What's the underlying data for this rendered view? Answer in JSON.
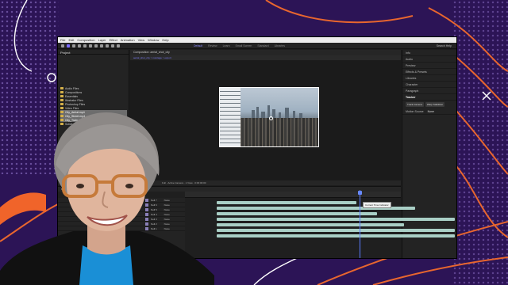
{
  "colors": {
    "background": "#2c1456",
    "accent_orange": "#f0642a",
    "app_bg": "#1d1d1d",
    "track_bar": "#a9cfc6",
    "playhead": "#5a7cff",
    "folder": "#d4b04a"
  },
  "menu": [
    "File",
    "Edit",
    "Composition",
    "Layer",
    "Effect",
    "Animation",
    "View",
    "Window",
    "Help"
  ],
  "toolbar": {
    "workspaces": [
      "Default",
      "Review",
      "Learn",
      "Small Screen",
      "Standard",
      "Libraries"
    ],
    "search_label": "Search Help"
  },
  "project_panel": {
    "title": "Project",
    "items": [
      "Audio Files",
      "Compositions",
      "Essentials",
      "Illustrator Files",
      "Photoshop Files",
      "Video Files",
      "City_Aerial.mp4",
      "City_Street.mp4",
      "City_Train.mp4",
      "Solids"
    ]
  },
  "composition": {
    "tab": "Composition: aerial_shot_city",
    "path": "aerial_shot_city  >  montage  >  export",
    "footer": "Full  ·  Active Camera  ·  1 View  ·  0:00:00:00"
  },
  "right_panel": {
    "items": [
      "Info",
      "Audio",
      "Preview",
      "Effects & Presets",
      "Libraries",
      "Character",
      "Paragraph"
    ],
    "tracker_header": "Tracker",
    "tracker_buttons": [
      "Track Camera",
      "Warp Stabilizer"
    ],
    "motion_source_label": "Motion Source",
    "motion_source_value": "None"
  },
  "timeline": {
    "tab": "starting order",
    "layers": [
      "Null 7",
      "Null 6",
      "Null 5",
      "Null 4",
      "Null 3",
      "Null 2",
      "Null 1"
    ],
    "parent": "None",
    "tooltip": "Current Time Indicator"
  },
  "icons": {
    "anchor": "anchor-point-icon",
    "folder": "folder-icon",
    "close": "close-x-icon",
    "ring": "ring-outline-icon"
  }
}
